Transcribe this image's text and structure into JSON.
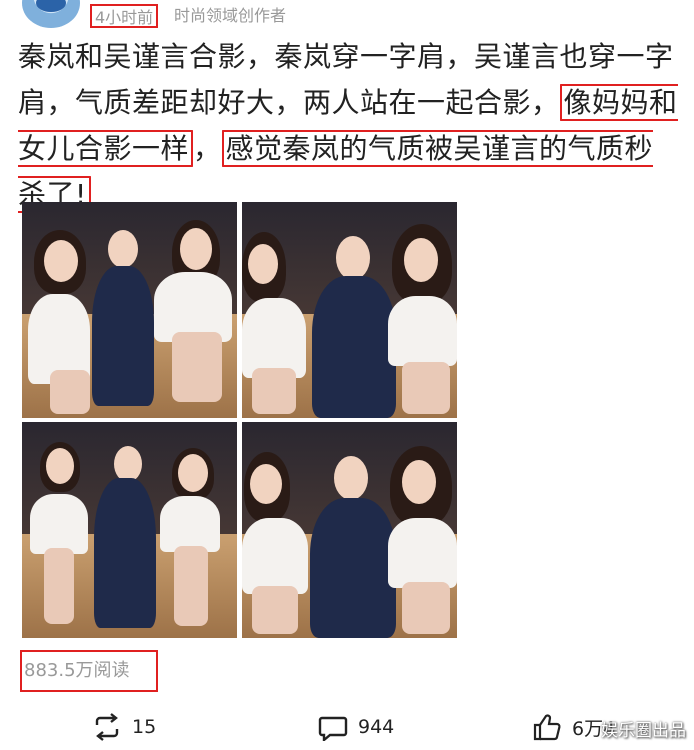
{
  "header": {
    "time": "4小时前",
    "author_tag": "时尚领域创作者"
  },
  "post": {
    "text_plain": "秦岚和吴谨言合影，秦岚穿一字肩，吴谨言也穿一字肩，气质差距却好大，两人站在一起合影，",
    "highlight_1": "像妈妈和女儿合影一样",
    "comma": "，",
    "highlight_2": "感觉秦岚的气质被吴谨言的气质秒杀了!"
  },
  "images": [
    {
      "label": "photo-1"
    },
    {
      "label": "photo-2"
    },
    {
      "label": "photo-3"
    },
    {
      "label": "photo-4"
    }
  ],
  "stats": {
    "reads": "883.5万阅读"
  },
  "actions": {
    "repost_count": "15",
    "comment_count": "944",
    "like_count": "6万4"
  },
  "watermark": "娱乐圈出品",
  "colors": {
    "highlight_border": "#e02020",
    "meta_text": "#999999"
  }
}
